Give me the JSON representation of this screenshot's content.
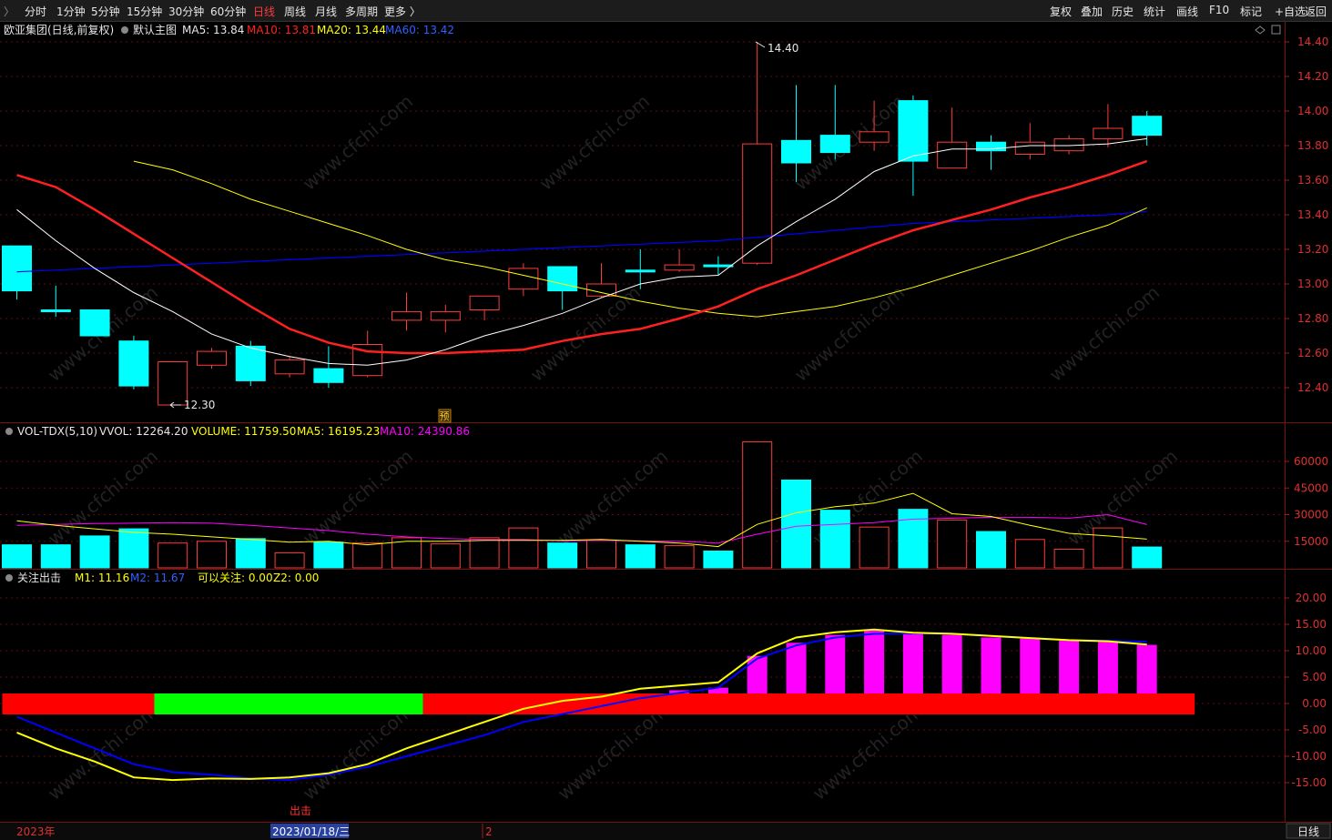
{
  "toolbar": {
    "left_tabs": [
      "分时",
      "1分钟",
      "5分钟",
      "15分钟",
      "30分钟",
      "60分钟",
      "日线",
      "周线",
      "月线",
      "多周期",
      "更多 〉"
    ],
    "active_tab": "日线",
    "right_buttons": [
      "复权",
      "叠加",
      "历史",
      "统计",
      "画线",
      "F10",
      "标记",
      "+自选",
      "返回"
    ],
    "corner_glyph": "〉"
  },
  "main_header": {
    "stock": "欧亚集团(日线,前复权)",
    "indicator": "默认主图",
    "ma5": "MA5: 13.84",
    "ma10": "MA10: 13.81",
    "ma20": "MA20: 13.44",
    "ma60": "MA60: 13.42"
  },
  "vol_header": {
    "name": "VOL-TDX(5,10)",
    "vvol": "VVOL: 12264.20",
    "volume": "VOLUME: 11759.50",
    "ma5": "MA5: 16195.23",
    "ma10": "MA10: 24390.86"
  },
  "ind_header": {
    "name": "关注出击",
    "m1": "M1: 11.16",
    "m2": "M2: 11.67",
    "watch": "可以关注: 0.00",
    "z2": "Z2: 0.00"
  },
  "annotations": {
    "high_label": "14.40",
    "low_label": "12.30",
    "pre_marker": "预",
    "sell_marker": "出击"
  },
  "bottom_axis": {
    "year_label": "2023年",
    "cursor_date": "2023/01/18/三",
    "month_label": "2",
    "period_button": "日线"
  },
  "watermark": "www.cfchi.com",
  "colors": {
    "up": "#ff3b3b",
    "down": "#00ffff",
    "ma5": "#ffffff",
    "ma10": "#ff2020",
    "ma20": "#ffff00",
    "ma60": "#0000ff",
    "vol_ma10": "#ff00ff",
    "green_band": "#00ff00",
    "red_band": "#ff0000",
    "bar_magenta": "#ff00ff"
  },
  "chart_data": [
    {
      "type": "candlestick",
      "title": "欧亚集团(日线,前复权)",
      "y_ticks": [
        12.4,
        12.6,
        12.8,
        13.0,
        13.2,
        13.4,
        13.6,
        13.8,
        14.0,
        14.2,
        14.4
      ],
      "ylim": [
        12.28,
        14.48
      ],
      "candles": [
        {
          "o": 13.22,
          "c": 12.96,
          "h": 13.22,
          "l": 12.91
        },
        {
          "o": 12.85,
          "c": 12.84,
          "h": 12.99,
          "l": 12.81
        },
        {
          "o": 12.85,
          "c": 12.7,
          "h": 12.85,
          "l": 12.7
        },
        {
          "o": 12.67,
          "c": 12.41,
          "h": 12.7,
          "l": 12.39
        },
        {
          "o": 12.3,
          "c": 12.55,
          "h": 12.55,
          "l": 12.3
        },
        {
          "o": 12.53,
          "c": 12.61,
          "h": 12.63,
          "l": 12.51
        },
        {
          "o": 12.64,
          "c": 12.44,
          "h": 12.67,
          "l": 12.41
        },
        {
          "o": 12.48,
          "c": 12.56,
          "h": 12.58,
          "l": 12.46
        },
        {
          "o": 12.51,
          "c": 12.43,
          "h": 12.64,
          "l": 12.4
        },
        {
          "o": 12.47,
          "c": 12.65,
          "h": 12.73,
          "l": 12.46
        },
        {
          "o": 12.79,
          "c": 12.84,
          "h": 12.95,
          "l": 12.73
        },
        {
          "o": 12.79,
          "c": 12.84,
          "h": 12.88,
          "l": 12.72
        },
        {
          "o": 12.85,
          "c": 12.93,
          "h": 12.93,
          "l": 12.79
        },
        {
          "o": 12.97,
          "c": 13.09,
          "h": 13.12,
          "l": 12.93
        },
        {
          "o": 13.1,
          "c": 12.96,
          "h": 13.1,
          "l": 12.85
        },
        {
          "o": 12.93,
          "c": 13.0,
          "h": 13.12,
          "l": 12.92
        },
        {
          "o": 13.08,
          "c": 13.07,
          "h": 13.2,
          "l": 12.97
        },
        {
          "o": 13.08,
          "c": 13.11,
          "h": 13.2,
          "l": 13.07
        },
        {
          "o": 13.11,
          "c": 13.1,
          "h": 13.16,
          "l": 13.05
        },
        {
          "o": 13.12,
          "c": 13.81,
          "h": 14.4,
          "l": 13.11
        },
        {
          "o": 13.83,
          "c": 13.7,
          "h": 14.15,
          "l": 13.59
        },
        {
          "o": 13.86,
          "c": 13.76,
          "h": 14.15,
          "l": 13.72
        },
        {
          "o": 13.82,
          "c": 13.88,
          "h": 14.06,
          "l": 13.77
        },
        {
          "o": 14.06,
          "c": 13.71,
          "h": 14.09,
          "l": 13.51
        },
        {
          "o": 13.67,
          "c": 13.82,
          "h": 14.02,
          "l": 13.67
        },
        {
          "o": 13.82,
          "c": 13.77,
          "h": 13.86,
          "l": 13.66
        },
        {
          "o": 13.75,
          "c": 13.82,
          "h": 13.93,
          "l": 13.72
        },
        {
          "o": 13.77,
          "c": 13.84,
          "h": 13.86,
          "l": 13.75
        },
        {
          "o": 13.84,
          "c": 13.9,
          "h": 14.04,
          "l": 13.79
        },
        {
          "o": 13.97,
          "c": 13.86,
          "h": 14.0,
          "l": 13.8
        }
      ],
      "ma5": [
        13.43,
        13.25,
        13.09,
        12.95,
        12.84,
        12.71,
        12.63,
        12.58,
        12.54,
        12.53,
        12.56,
        12.62,
        12.7,
        12.76,
        12.83,
        12.92,
        13.0,
        13.04,
        13.05,
        13.22,
        13.36,
        13.49,
        13.65,
        13.74,
        13.78,
        13.78,
        13.8,
        13.8,
        13.81,
        13.84
      ],
      "ma10": [
        13.63,
        13.56,
        13.43,
        13.29,
        13.15,
        13.01,
        12.87,
        12.74,
        12.66,
        12.61,
        12.6,
        12.6,
        12.61,
        12.62,
        12.67,
        12.71,
        12.74,
        12.8,
        12.87,
        12.97,
        13.05,
        13.14,
        13.23,
        13.31,
        13.37,
        13.43,
        13.5,
        13.56,
        13.63,
        13.71,
        13.8,
        13.81
      ],
      "ma20": [
        13.71,
        13.66,
        13.58,
        13.49,
        13.42,
        13.35,
        13.28,
        13.2,
        13.14,
        13.1,
        13.05,
        13.0,
        12.95,
        12.9,
        12.86,
        12.83,
        12.81,
        12.84,
        12.87,
        12.92,
        12.98,
        13.05,
        13.12,
        13.19,
        13.27,
        13.34,
        13.44
      ],
      "ma60": [
        13.07,
        13.08,
        13.09,
        13.1,
        13.11,
        13.12,
        13.13,
        13.14,
        13.15,
        13.16,
        13.17,
        13.18,
        13.19,
        13.2,
        13.21,
        13.22,
        13.23,
        13.24,
        13.25,
        13.27,
        13.29,
        13.31,
        13.33,
        13.35,
        13.36,
        13.37,
        13.38,
        13.39,
        13.4,
        13.42
      ]
    },
    {
      "type": "bar",
      "title": "VOL-TDX(5,10)",
      "y_ticks": [
        15000,
        30000,
        45000,
        60000
      ],
      "ylim": [
        0,
        72000
      ],
      "volume": [
        13000,
        13000,
        18000,
        22000,
        14000,
        15000,
        16500,
        8500,
        14500,
        14000,
        17000,
        13500,
        17000,
        22500,
        14000,
        15500,
        13000,
        12500,
        9500,
        71000,
        49500,
        32500,
        23000,
        33000,
        27000,
        20500,
        16000,
        10500,
        22500,
        11759.5
      ],
      "vol_ma5": [
        26500,
        24000,
        22000,
        20000,
        19000,
        17500,
        16000,
        14500,
        15000,
        13000,
        15000,
        15000,
        15500,
        15500,
        15500,
        16000,
        15000,
        14000,
        12000,
        24500,
        31000,
        34500,
        36500,
        42000,
        30500,
        29000,
        24000,
        19500,
        18000,
        16195.23
      ],
      "vol_ma10": [
        24000,
        24500,
        25000,
        25200,
        25500,
        25200,
        24000,
        22500,
        21000,
        19000,
        17500,
        16500,
        16000,
        16000,
        15200,
        15500,
        15200,
        15000,
        14000,
        19000,
        23500,
        24500,
        25500,
        27500,
        28000,
        28500,
        28500,
        28000,
        30000,
        24390.86
      ]
    },
    {
      "type": "bar",
      "title": "关注出击",
      "y_ticks": [
        -15,
        -10,
        -5,
        0,
        5,
        10,
        15,
        20
      ],
      "ylim": [
        -20,
        22.5
      ],
      "bars": [
        0,
        0,
        0,
        0,
        0,
        0,
        0,
        0,
        0,
        0,
        0,
        0,
        0,
        0,
        0,
        0,
        1.5,
        2.5,
        3,
        9,
        11.5,
        13,
        14,
        13.3,
        13,
        12.5,
        12.3,
        12,
        11.7,
        11.1
      ],
      "m1": [
        -5.5,
        -8.5,
        -11,
        -14,
        -14.5,
        -14.2,
        -14.3,
        -14,
        -13.2,
        -11.5,
        -8.5,
        -6,
        -3.5,
        -1,
        0.5,
        1.3,
        2.8,
        3.4,
        4,
        9.5,
        12.5,
        13.5,
        14,
        13.4,
        13.2,
        12.8,
        12.4,
        12,
        11.8,
        11.16
      ],
      "m2": [
        -2.5,
        -5.5,
        -8.5,
        -11.5,
        -13,
        -13.5,
        -14.2,
        -14.5,
        -13.5,
        -12,
        -10,
        -8,
        -6,
        -3.5,
        -2,
        -0.5,
        1,
        2,
        3,
        8.5,
        11,
        12.5,
        13.2,
        13.3,
        13.2,
        12.8,
        12.4,
        12,
        11.9,
        11.67
      ],
      "band_segments": [
        {
          "from": 0,
          "to": 3.9,
          "color": "red"
        },
        {
          "from": 3.9,
          "to": 10.8,
          "color": "green"
        },
        {
          "from": 10.8,
          "to": 30.6,
          "color": "red"
        }
      ]
    }
  ]
}
